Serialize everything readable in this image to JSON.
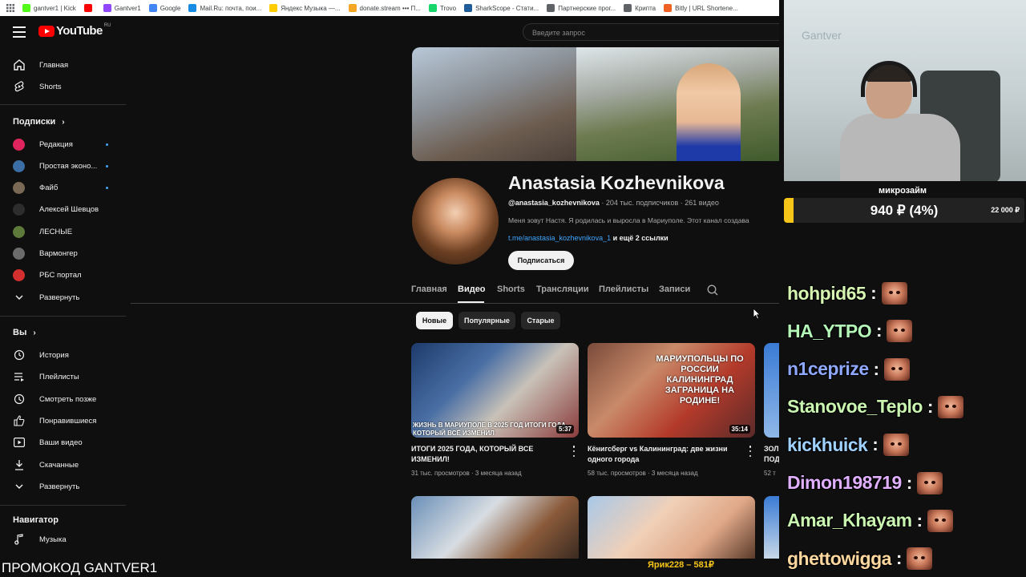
{
  "bookmarks": [
    {
      "label": "gantver1 | Kick",
      "icon": "kick-icon",
      "color": "#53fc18"
    },
    {
      "label": "",
      "icon": "youtube-icon",
      "color": "#ff0000"
    },
    {
      "label": "Gantver1",
      "icon": "twitch-icon",
      "color": "#9146ff"
    },
    {
      "label": "Google",
      "icon": "google-icon",
      "color": "#4285f4"
    },
    {
      "label": "Mail.Ru: почта, пои...",
      "icon": "mail-icon",
      "color": "#168de2"
    },
    {
      "label": "Яндекс Музыка —...",
      "icon": "yandex-music-icon",
      "color": "#ffcc00"
    },
    {
      "label": "donate.stream ••• П...",
      "icon": "donate-icon",
      "color": "#f5a623"
    },
    {
      "label": "Trovo",
      "icon": "trovo-icon",
      "color": "#19d66b"
    },
    {
      "label": "SharkScope - Стати...",
      "icon": "sharkscope-icon",
      "color": "#1f5c99"
    },
    {
      "label": "Партнерские прог...",
      "icon": "folder-icon",
      "color": "#5f6368"
    },
    {
      "label": "Крипта",
      "icon": "folder-icon",
      "color": "#5f6368"
    },
    {
      "label": "Bitly | URL Shortene...",
      "icon": "bitly-icon",
      "color": "#ee6123"
    }
  ],
  "topbar": {
    "logo": "YouTube",
    "region": "RU",
    "search_placeholder": "Введите запрос"
  },
  "sidebar": {
    "main": [
      {
        "label": "Главная",
        "icon": "home-icon"
      },
      {
        "label": "Shorts",
        "icon": "shorts-icon"
      }
    ],
    "subscriptions_title": "Подписки",
    "subscriptions": [
      {
        "label": "Редакция",
        "color": "#e0245e",
        "new": true
      },
      {
        "label": "Простая эконо...",
        "color": "#3a6ea5",
        "new": true
      },
      {
        "label": "Файб",
        "color": "#7a6a55",
        "new": true
      },
      {
        "label": "Алексей Шевцов",
        "color": "#2d2d2d",
        "new": false
      },
      {
        "label": "ЛЕСНЫЕ",
        "color": "#5d7a3a",
        "new": false
      },
      {
        "label": "Вармонгер",
        "color": "#6b6b6b",
        "new": false
      },
      {
        "label": "РБС портал",
        "color": "#d32f2f",
        "new": false
      }
    ],
    "expand_label": "Развернуть",
    "you_title": "Вы",
    "you_items": [
      {
        "label": "История",
        "icon": "history-icon"
      },
      {
        "label": "Плейлисты",
        "icon": "playlists-icon"
      },
      {
        "label": "Смотреть позже",
        "icon": "watch-later-icon"
      },
      {
        "label": "Понравившиеся",
        "icon": "thumbs-up-icon"
      },
      {
        "label": "Ваши видео",
        "icon": "your-videos-icon"
      },
      {
        "label": "Скачанные",
        "icon": "download-icon"
      }
    ],
    "expand_label_2": "Развернуть",
    "navigator_title": "Навигатор",
    "navigator_items": [
      {
        "label": "Музыка",
        "icon": "music-icon"
      }
    ]
  },
  "channel": {
    "name": "Anastasia Kozhevnikova",
    "handle": "@anastasia_kozhevnikova",
    "subscribers": "204 тыс. подписчиков",
    "videos_count": "261 видео",
    "description": "Меня зовут Настя. Я родилась и выросла в Мариуполе. Этот канал создава",
    "link": "t.me/anastasia_kozhevnikova_1",
    "more_links": "и ещё 2 ссылки",
    "subscribe_label": "Подписаться"
  },
  "tabs": [
    "Главная",
    "Видео",
    "Shorts",
    "Трансляции",
    "Плейлисты",
    "Записи"
  ],
  "chips": [
    "Новые",
    "Популярные",
    "Старые"
  ],
  "videos": [
    {
      "title": "ИТОГИ 2025 ГОДА, КОТОРЫЙ ВСЕ ИЗМЕНИЛ!",
      "views": "31 тыс. просмотров",
      "age": "3 месяца назад",
      "duration": "5:37",
      "thumb_text": "ЖИЗНЬ В МАРИУПОЛЕ В 2025 ГОД ИТОГИ ГОДА, КОТОРЫЙ ВСЁ ИЗМЕНИЛ"
    },
    {
      "title": "Кёнигсберг vs Калининград: две жизни одного города",
      "views": "58 тыс. просмотров",
      "age": "3 месяца назад",
      "duration": "35:14",
      "thumb_text": "МАРИУПОЛЬЦЫ ПО РОССИИ КАЛИНИНГРАД ЗАГРАНИЦА НА РОДИНЕ!"
    },
    {
      "title": "ЗОЛ ПОД",
      "views": "52 т",
      "age": "",
      "duration": "",
      "thumb_text": ""
    }
  ],
  "webcam": {
    "wall_text": "Gantver"
  },
  "donation": {
    "goal_title": "микрозайм",
    "current": "940 ₽ (4%)",
    "target": "22 000 ₽",
    "progress": 0.04,
    "color": "#f6c51a"
  },
  "chat": [
    {
      "user": "hohpid65",
      "color": "#d5f5b0"
    },
    {
      "user": "HA_YTPO",
      "color": "#b4f5b8"
    },
    {
      "user": "n1ceprize",
      "color": "#8fa8ff"
    },
    {
      "user": "Stanovoe_Teplo",
      "color": "#c9f5b0"
    },
    {
      "user": "kickhuick",
      "color": "#9fd1ff"
    },
    {
      "user": "Dimon198719",
      "color": "#e0b0ff"
    },
    {
      "user": "Amar_Khayam",
      "color": "#c9f5b0"
    },
    {
      "user": "ghettowigga",
      "color": "#ffd89f"
    }
  ],
  "promo_text": "ПРОМОКОД GANTVER1",
  "last_donation": "Ярик228 – 581₽"
}
